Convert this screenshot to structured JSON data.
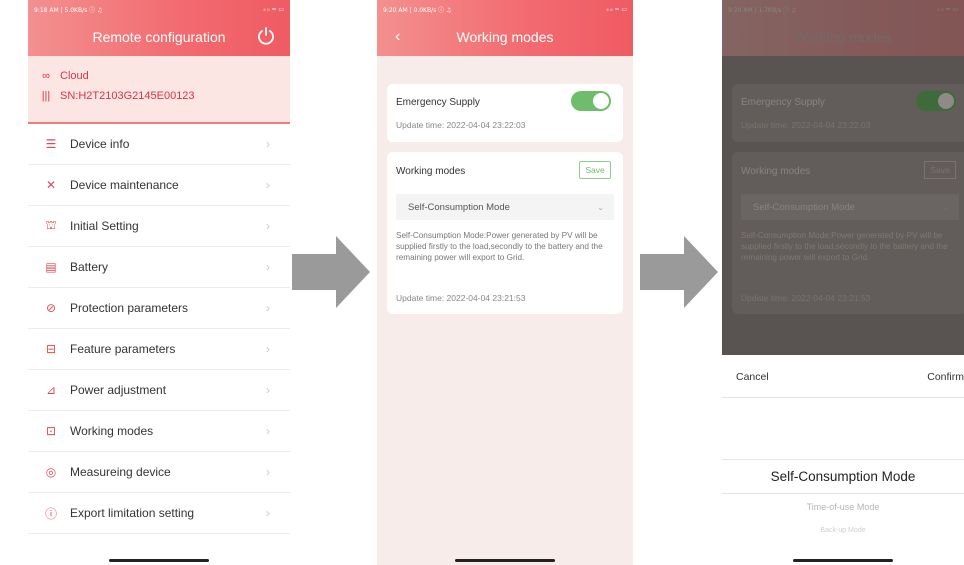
{
  "colors": {
    "accent": "#ef5b63",
    "toggle_on": "#6dbd6a",
    "cloud_bg": "#fbe6e3"
  },
  "status": {
    "p1_left": "9:18 AM | 5.0KB/s ⓘ ♫",
    "p1_right": "ᵢₗ ᵢₗ ≈ ▭",
    "p2_left": "9:20 AM | 0.0KB/s ⓘ ♫",
    "p2_right": "ᵢₗ ᵢₗ ≈ ▭",
    "p3_left": "9:20 AM | 1.7KB/s ⓘ ♫",
    "p3_right": "ᵢₗ ᵢₗ ≈ ▭"
  },
  "panel1": {
    "title": "Remote configuration",
    "cloud_label": "Cloud",
    "serial": "SN:H2T2103G2145E00123",
    "menu": [
      {
        "label": "Device info",
        "icon": "document-list-icon",
        "glyph": "☰"
      },
      {
        "label": "Device maintenance",
        "icon": "wrench-screwdriver-icon",
        "glyph": "✕"
      },
      {
        "label": "Initial Setting",
        "icon": "building-icon",
        "glyph": "⛫"
      },
      {
        "label": "Battery",
        "icon": "battery-icon",
        "glyph": "▤"
      },
      {
        "label": "Protection parameters",
        "icon": "shield-circle-icon",
        "glyph": "⊘"
      },
      {
        "label": "Feature parameters",
        "icon": "toolbox-icon",
        "glyph": "⊟"
      },
      {
        "label": "Power adjustment",
        "icon": "chart-adjust-icon",
        "glyph": "⊿"
      },
      {
        "label": "Working modes",
        "icon": "mode-icon",
        "glyph": "⊡"
      },
      {
        "label": "Measureing device",
        "icon": "meter-icon",
        "glyph": "◎"
      },
      {
        "label": "Export limitation setting",
        "icon": "info-circle-icon",
        "glyph": "ⓘ"
      }
    ]
  },
  "panel2": {
    "title": "Working modes",
    "emergency_label": "Emergency Supply",
    "emergency_update": "Update time: 2022-04-04 23:22:03",
    "modes_label": "Working modes",
    "save_label": "Save",
    "selected_mode": "Self-Consumption Mode",
    "description": "Self-Consumption Mode:Power generated by PV will be supplied firstly to the load,secondly to the battery and the remaining power will export to Grid.",
    "modes_update": "Update time: 2022-04-04 23:21:53"
  },
  "panel3": {
    "title": "Working modes",
    "emergency_label": "Emergency Supply",
    "emergency_update": "Update time: 2022-04-04 23:22:03",
    "modes_label": "Working modes",
    "save_label": "Save",
    "selected_mode": "Self-Consumption Mode",
    "description": "Self-Consumption Mode:Power generated by PV will be supplied firstly to the load,secondly to the battery and the remaining power will export to Grid.",
    "modes_update": "Update time: 2022-04-04 23:21:53",
    "picker": {
      "cancel_label": "Cancel",
      "confirm_label": "Confirm",
      "options": [
        "Self-Consumption Mode",
        "Time-of-use Mode",
        "Back-up Mode"
      ]
    }
  }
}
